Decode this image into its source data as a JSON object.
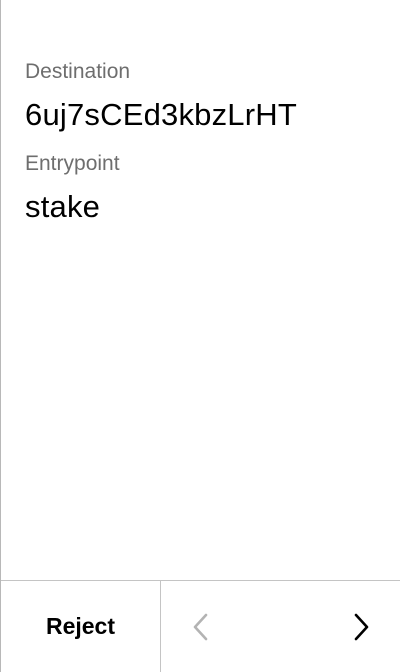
{
  "fields": [
    {
      "label": "Destination",
      "value": "6uj7sCEd3kbzLrHT"
    },
    {
      "label": "Entrypoint",
      "value": "stake"
    }
  ],
  "footer": {
    "reject_label": "Reject",
    "prev_icon": "chevron-left-icon",
    "next_icon": "chevron-right-icon",
    "prev_enabled": false,
    "next_enabled": true
  },
  "colors": {
    "label": "#6e6e6e",
    "value": "#000000",
    "divider": "#c4c4c4",
    "disabled_icon": "#b3b3b3"
  }
}
